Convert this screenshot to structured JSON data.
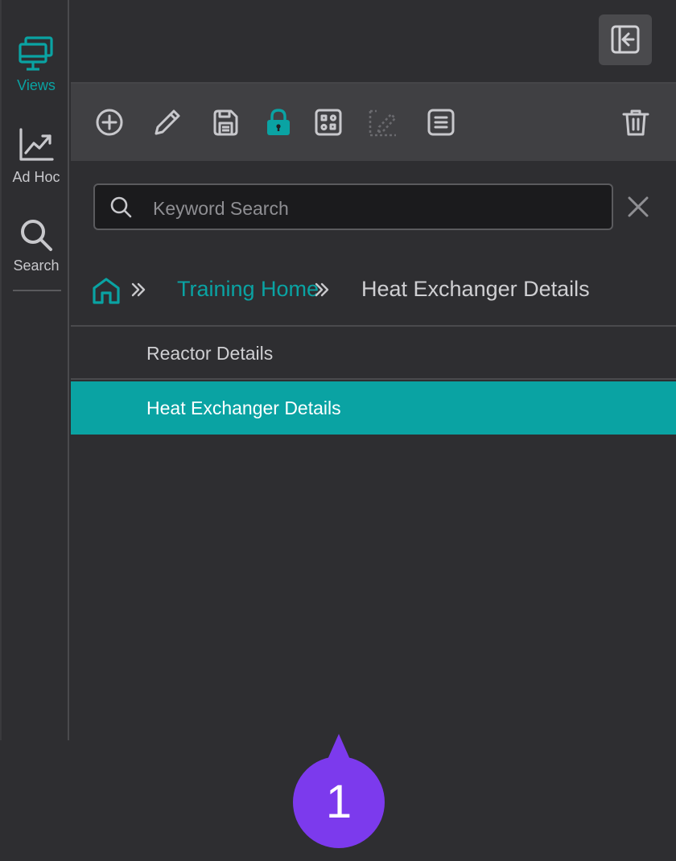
{
  "rail": {
    "items": [
      {
        "label": "Views",
        "icon": "views-monitor-icon",
        "active": true
      },
      {
        "label": "Ad Hoc",
        "icon": "trend-chart-icon",
        "active": false
      },
      {
        "label": "Search",
        "icon": "search-icon",
        "active": false
      }
    ]
  },
  "toolbar": {
    "icons": [
      "add-circle-icon",
      "edit-pencil-icon",
      "save-icon",
      "lock-icon",
      "layout-icon",
      "edit-disabled-icon",
      "list-icon",
      "trash-icon"
    ]
  },
  "search": {
    "placeholder": "Keyword Search",
    "value": ""
  },
  "breadcrumb": {
    "link": "Training Home",
    "current": "Heat Exchanger Details"
  },
  "list": {
    "items": [
      {
        "label": "Reactor Details",
        "selected": false
      },
      {
        "label": "Heat Exchanger Details",
        "selected": true
      }
    ]
  },
  "badge": {
    "number": "1"
  },
  "colors": {
    "accent": "#0aa3a3",
    "badge": "#7c3aed",
    "background": "#2e2e31",
    "toolbar": "#404043"
  }
}
